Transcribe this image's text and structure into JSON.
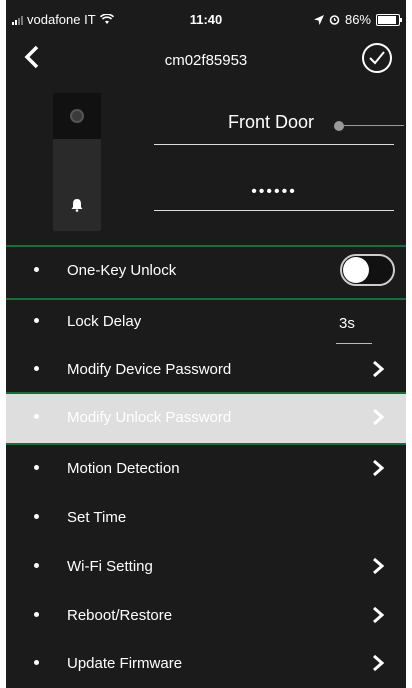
{
  "status_bar": {
    "carrier": "vodafone IT",
    "time": "11:40",
    "battery_text": "86%",
    "wifi_icon": "wifi-icon",
    "location_icon": "location-arrow-icon",
    "alarm_icon": "alarm-icon"
  },
  "navbar": {
    "title": "cm02f85953",
    "back_icon": "chevron-left-icon",
    "confirm_icon": "check-circle-icon"
  },
  "device": {
    "name": "Front Door",
    "password_mask": "••••••"
  },
  "settings": {
    "one_key_unlock": {
      "label": "One-Key Unlock",
      "enabled": false
    },
    "lock_delay": {
      "label": "Lock Delay",
      "value": "3s"
    },
    "modify_device_password": {
      "label": "Modify Device Password"
    },
    "modify_unlock_password": {
      "label": "Modify Unlock Password"
    },
    "motion_detection": {
      "label": "Motion Detection"
    },
    "set_time": {
      "label": "Set Time"
    },
    "wifi_setting": {
      "label": "Wi-Fi Setting"
    },
    "reboot_restore": {
      "label": "Reboot/Restore"
    },
    "update_firmware": {
      "label": "Update Firmware"
    }
  },
  "colors": {
    "background": "#1b1b1b",
    "highlight_row": "#dedede",
    "separator_green": "#1e6a3a",
    "text": "#ffffff"
  }
}
